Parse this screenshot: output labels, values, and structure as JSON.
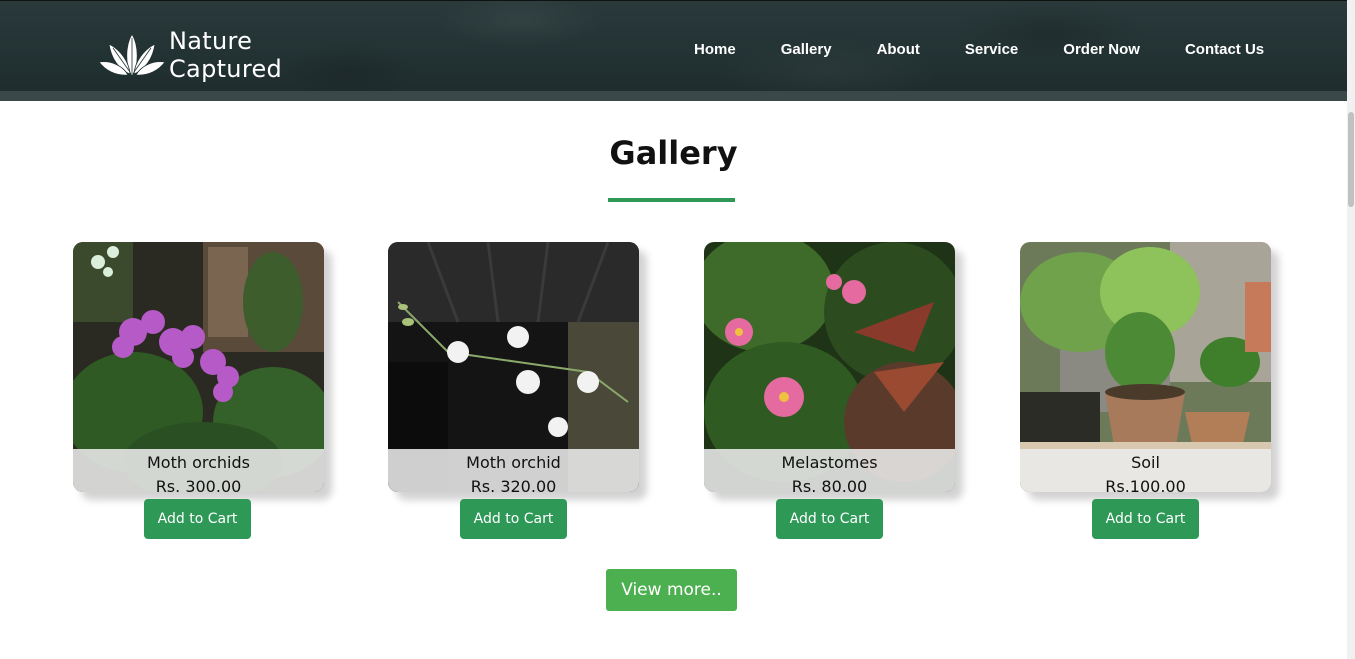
{
  "brand": {
    "line1": "Nature",
    "line2": "Captured"
  },
  "nav": [
    {
      "label": "Home"
    },
    {
      "label": "Gallery"
    },
    {
      "label": "About"
    },
    {
      "label": "Service"
    },
    {
      "label": "Order Now"
    },
    {
      "label": "Contact Us"
    }
  ],
  "gallery": {
    "title": "Gallery",
    "items": [
      {
        "name": "Moth orchids",
        "price": "Rs. 300.00",
        "button": "Add to Cart"
      },
      {
        "name": "Moth orchid",
        "price": "Rs. 320.00",
        "button": "Add to Cart"
      },
      {
        "name": "Melastomes",
        "price": "Rs. 80.00",
        "button": "Add to Cart"
      },
      {
        "name": "Soil",
        "price": "Rs.100.00",
        "button": "Add to Cart"
      }
    ],
    "view_more": "View more.."
  },
  "colors": {
    "header": "#223132",
    "accent": "#2e9856",
    "view_more": "#4caf50"
  }
}
